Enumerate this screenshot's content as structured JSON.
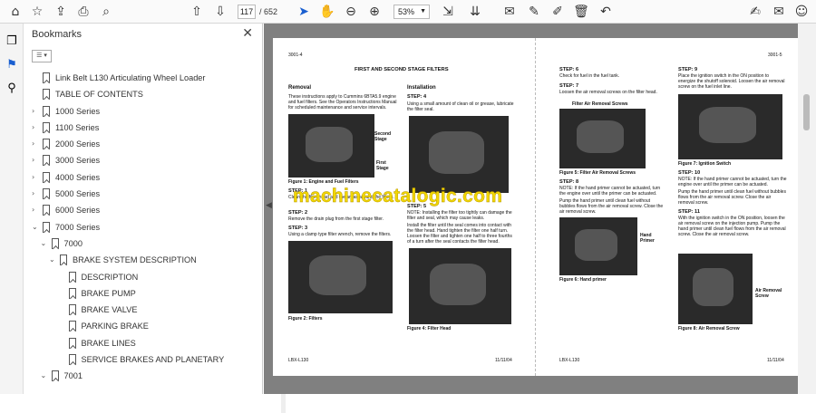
{
  "toolbar": {
    "page_current": "117",
    "page_total": "/ 652",
    "zoom": "53%"
  },
  "bookmarks": {
    "title": "Bookmarks",
    "items": [
      {
        "label": "Link Belt L130 Articulating Wheel Loader",
        "level": 0,
        "toggle": ""
      },
      {
        "label": "TABLE OF CONTENTS",
        "level": 0,
        "toggle": ""
      },
      {
        "label": "1000 Series",
        "level": 0,
        "toggle": "›"
      },
      {
        "label": "1100 Series",
        "level": 0,
        "toggle": "›"
      },
      {
        "label": "2000 Series",
        "level": 0,
        "toggle": "›"
      },
      {
        "label": "3000 Series",
        "level": 0,
        "toggle": "›"
      },
      {
        "label": "4000 Series",
        "level": 0,
        "toggle": "›"
      },
      {
        "label": "5000 Series",
        "level": 0,
        "toggle": "›"
      },
      {
        "label": "6000 Series",
        "level": 0,
        "toggle": "›"
      },
      {
        "label": "7000 Series",
        "level": 0,
        "toggle": "⌄"
      },
      {
        "label": "7000",
        "level": 1,
        "toggle": "⌄"
      },
      {
        "label": "BRAKE SYSTEM DESCRIPTION",
        "level": 2,
        "toggle": "⌄"
      },
      {
        "label": "DESCRIPTION",
        "level": 3,
        "toggle": ""
      },
      {
        "label": "BRAKE PUMP",
        "level": 3,
        "toggle": ""
      },
      {
        "label": "BRAKE VALVE",
        "level": 3,
        "toggle": ""
      },
      {
        "label": "PARKING BRAKE",
        "level": 3,
        "toggle": ""
      },
      {
        "label": "BRAKE LINES",
        "level": 3,
        "toggle": ""
      },
      {
        "label": "SERVICE BRAKES AND PLANETARY",
        "level": 3,
        "toggle": ""
      },
      {
        "label": "7001",
        "level": 1,
        "toggle": "⌄"
      }
    ]
  },
  "doc": {
    "left_header": "3001-4",
    "right_header": "3001-5",
    "title": "FIRST AND SECOND STAGE FILTERS",
    "removal": "Removal",
    "installation": "Installation",
    "removal_text": "These instructions apply to Cummins 6BTA5.9 engine and fuel filters. See the Operators Instructions Manual for scheduled maintenance and service intervals.",
    "second_stage": "Second Stage",
    "first_stage": "First Stage",
    "fig1": "Figure 1: Engine and Fuel Filters",
    "step1": "STEP: 1",
    "step1_text": "Clean the filter head and the areas around the filters.",
    "step2": "STEP: 2",
    "step2_text": "Remove the drain plug from the first stage filter.",
    "step3": "STEP: 3",
    "step3_text": "Using a clamp type filter wrench, remove the filters.",
    "fig2": "Figure 2: Filters",
    "step4": "STEP: 4",
    "step4_text": "Using a small amount of clean oil or grease, lubricate the filter seal.",
    "step5": "STEP: 5",
    "step5_text": "NOTE: Installing the filter too tightly can damage the filter and seal, which may cause leaks.",
    "step5_text2": "Install the filter until the seal comes into contact with the filter head. Hand tighten the filter one half turn. Loosen the filter and tighten one half to three fourths of a turn after the seal contacts the filter head.",
    "fig4": "Figure 4: Filter Head",
    "step6": "STEP: 6",
    "step6_text": "Check for fuel in the fuel tank.",
    "step7": "STEP: 7",
    "step7_text": "Loosen the air removal screws on the filter head.",
    "filter_air": "Filter Air Removal Screws",
    "fig5": "Figure 5: Filter Air Removal Screws",
    "step8": "STEP: 8",
    "step8_text": "NOTE: If the hand primer cannot be actuated, turn the engine over until the primer can be actuated.",
    "step8_text2": "Pump the hand primer until clean fuel without bubbles flows from the air removal screw. Close the air removal screw.",
    "hand_primer": "Hand Primer",
    "fig6": "Figure 6: Hand primer",
    "step9": "STEP: 9",
    "step9_text": "Place the ignition switch in the ON position to energize the shutoff solenoid. Loosen the air removal screw on the fuel inlet line.",
    "fig7": "Figure 7: Ignition Switch",
    "step10": "STEP: 10",
    "step10_text": "NOTE: If the hand primer cannot be actuated, turn the engine over until the primer can be actuated.",
    "step10_text2": "Pump the hand primer until clean fuel without bubbles flows from the air removal screw. Close the air removal screw.",
    "step11": "STEP: 11",
    "step11_text": "With the ignition switch in the ON position, loosen the air removal screw on the injection pump. Pump the hand primer until clean fuel flows from the air removal screw. Close the air removal screw.",
    "air_removal": "Air Removal Screw",
    "fig8": "Figure 8: Air Removal Screw",
    "footer_left": "LBX-L130",
    "footer_date_l": "11/11/04",
    "footer_left2": "LBX-L130",
    "footer_date_r": "11/11/04"
  },
  "watermark": "machinecatalogic.com"
}
